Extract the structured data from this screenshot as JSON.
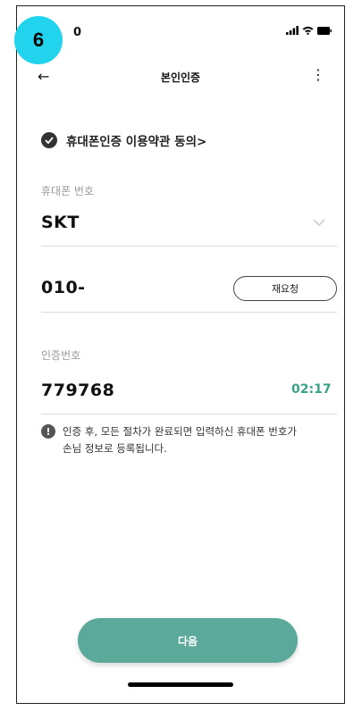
{
  "annotation": {
    "step_number": "6"
  },
  "status_bar": {
    "time_fragment": "0"
  },
  "header": {
    "back_glyph": "←",
    "title": "본인인증",
    "more_glyph": "⋮"
  },
  "agreement": {
    "label": "휴대폰인증 이용약관 동의>"
  },
  "phone": {
    "label": "휴대폰 번호",
    "carrier": "SKT",
    "number_value": "010-",
    "resend_label": "재요청"
  },
  "verification": {
    "label": "인증번호",
    "code_value": "779768",
    "timer": "02:17"
  },
  "notice": {
    "text": "인증 후, 모든 절차가 완료되면 입력하신 휴대폰 번호가 손님 정보로 등록됩니다."
  },
  "next_button": {
    "label": "다음"
  },
  "colors": {
    "accent": "#5aa99a",
    "timer": "#3aa388",
    "badge": "#22d3ee"
  }
}
